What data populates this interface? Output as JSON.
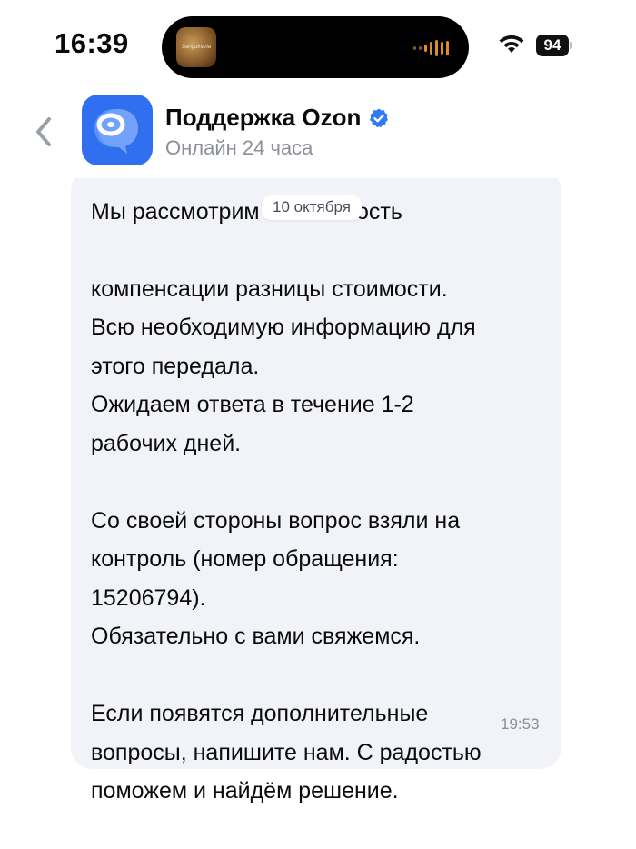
{
  "status_bar": {
    "time": "16:39",
    "now_playing_art_text": "Sanguinaria",
    "battery_level": "94",
    "wifi_icon": "wifi-icon",
    "battery_icon": "battery-icon"
  },
  "header": {
    "back_icon": "chevron-left-icon",
    "title": "Поддержка Ozon",
    "verified_icon": "verified-check-icon",
    "subtitle": "Онлайн 24 часа",
    "accent_color": "#2f6ff0"
  },
  "chat": {
    "date_chip": "10 октября",
    "message": {
      "clipped_top_line": "Мы рассмотрим возможность",
      "text": "компенсации разницы стоимости.\nВсю необходимую информацию для\nэтого передала.\nОжидаем ответа в течение 1-2\nрабочих дней.\n\nСо своей стороны вопрос взяли на\nконтроль (номер обращения:\n15206794).\nОбязательно с вами свяжемся.\n\nЕсли появятся дополнительные\nвопросы, напишите нам. С радостью\nпоможем и найдём решение.",
      "time": "19:53"
    }
  }
}
